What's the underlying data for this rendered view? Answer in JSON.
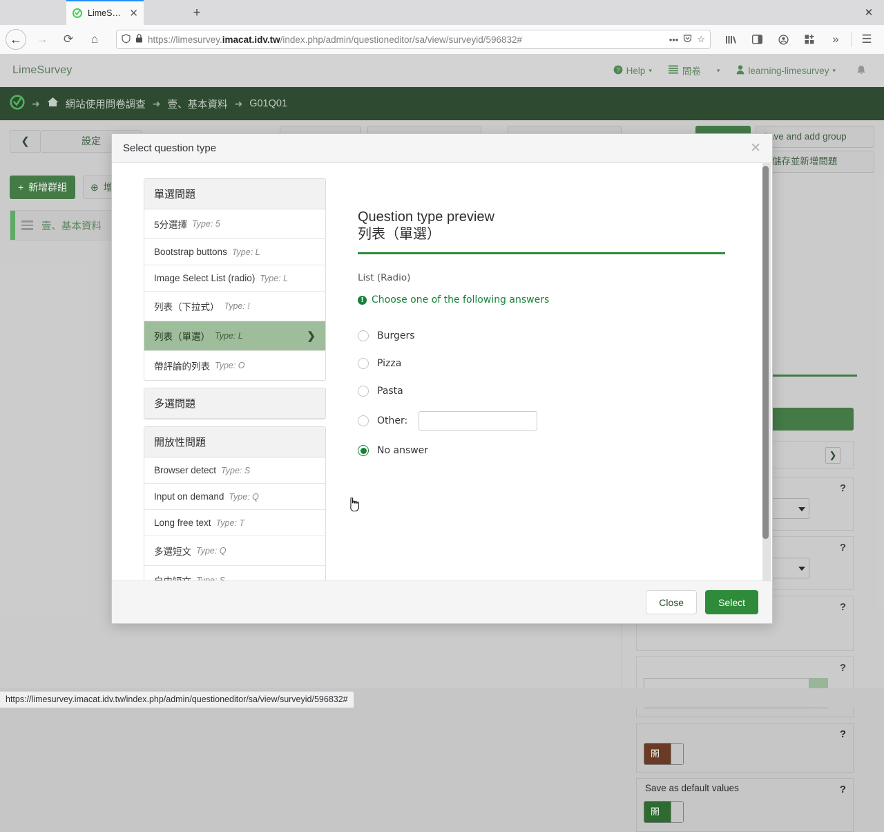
{
  "browser": {
    "tab": {
      "title": "LimeSurvey",
      "favicon_icon": "limesurvey-icon",
      "close_icon": "✕"
    },
    "new_tab_icon": "+",
    "window_close_icon": "✕",
    "nav": {
      "back_icon": "←",
      "forward_icon": "→",
      "reload_icon": "⟳",
      "home_icon": "⌂"
    },
    "url": {
      "shield_icon": "shield-icon",
      "lock_icon": "lock-icon",
      "prefix": "https://limesurvey.",
      "domain": "imacat.idv.tw",
      "suffix": "/index.php/admin/questioneditor/sa/view/surveyid/596832#",
      "ellipsis_icon": "•••",
      "pocket_icon": "pocket-icon",
      "bookmark_icon": "☆"
    },
    "toolbar_icons": [
      "library-icon",
      "sidebar-icon",
      "account-icon",
      "extensions-icon",
      "overflow-icon",
      "menu-icon"
    ]
  },
  "app": {
    "brand": "LimeSurvey",
    "topnav": [
      {
        "label": "Help",
        "icon": "question-circle-icon",
        "caret": "▾"
      },
      {
        "label": "問卷",
        "icon": "list-icon",
        "caret": "▾"
      },
      {
        "label": "learning-limesurvey",
        "icon": "user-icon",
        "caret": "▾"
      }
    ],
    "bell_icon": "bell-icon",
    "breadcrumb": {
      "logo_icon": "limesurvey-logo-icon",
      "home_icon": "home-icon",
      "arrow": "➜",
      "items": [
        "網站使用問卷調查",
        "壹、基本資料",
        "G01Q01"
      ]
    },
    "left": {
      "collapse_icon": "chevron-left-icon",
      "settings_tab": "設定",
      "new_group_button": "新增群組",
      "new_group_icon": "+",
      "add_question_button": "增",
      "add_question_icon": "⊕",
      "group_item": "壹、基本資料",
      "group_drag_icon": "hamburger-icon"
    },
    "action_bar": {
      "save_and_add_group": "Save and add group",
      "save_and_add_question": "儲存並新增問題",
      "save_and_add_question_icon": "+"
    },
    "right_panel": {
      "help_icon": "?",
      "chevron_icon": "❯",
      "toggle_on_label": "開",
      "brace_glyph": "}",
      "save_as_default_values": "Save as default values"
    }
  },
  "modal": {
    "title": "Select question type",
    "close_icon": "✕",
    "groups": [
      {
        "header": "單選問題",
        "items": [
          {
            "label": "5分選擇",
            "type": "Type: 5",
            "selected": false
          },
          {
            "label": "Bootstrap buttons",
            "type": "Type: L",
            "selected": false
          },
          {
            "label": "Image Select List (radio)",
            "type": "Type: L",
            "selected": false
          },
          {
            "label": "列表（下拉式）",
            "type": "Type: !",
            "selected": false
          },
          {
            "label": "列表（單選）",
            "type": "Type: L",
            "selected": true
          },
          {
            "label": "帶評論的列表",
            "type": "Type: O",
            "selected": false
          }
        ]
      },
      {
        "header": "多選問題",
        "items": []
      },
      {
        "header": "開放性問題",
        "items": [
          {
            "label": "Browser detect",
            "type": "Type: S",
            "selected": false
          },
          {
            "label": "Input on demand",
            "type": "Type: Q",
            "selected": false
          },
          {
            "label": "Long free text",
            "type": "Type: T",
            "selected": false
          },
          {
            "label": "多選短文",
            "type": "Type: Q",
            "selected": false
          },
          {
            "label": "自由短文",
            "type": "Type: S",
            "selected": false
          }
        ]
      }
    ],
    "selected_chevron": "❯",
    "preview": {
      "heading": "Question type preview",
      "subheading": "列表（單選）",
      "question_label": "List (Radio)",
      "hint_icon": "!",
      "hint": "Choose one of the following answers",
      "answers": [
        {
          "label": "Burgers",
          "checked": false,
          "has_input": false
        },
        {
          "label": "Pizza",
          "checked": false,
          "has_input": false
        },
        {
          "label": "Pasta",
          "checked": false,
          "has_input": false
        },
        {
          "label": "Other:",
          "checked": false,
          "has_input": true,
          "input_value": ""
        },
        {
          "label": "No answer",
          "checked": true,
          "has_input": false
        }
      ]
    },
    "footer": {
      "close_label": "Close",
      "select_label": "Select"
    }
  },
  "status_bar": {
    "url": "https://limesurvey.imacat.idv.tw/index.php/admin/questioneditor/sa/view/surveyid/596832#"
  },
  "colors": {
    "brand_green": "#2e8b3a",
    "dark_green": "#17361a",
    "accent_selected": "#9dbd9b"
  }
}
